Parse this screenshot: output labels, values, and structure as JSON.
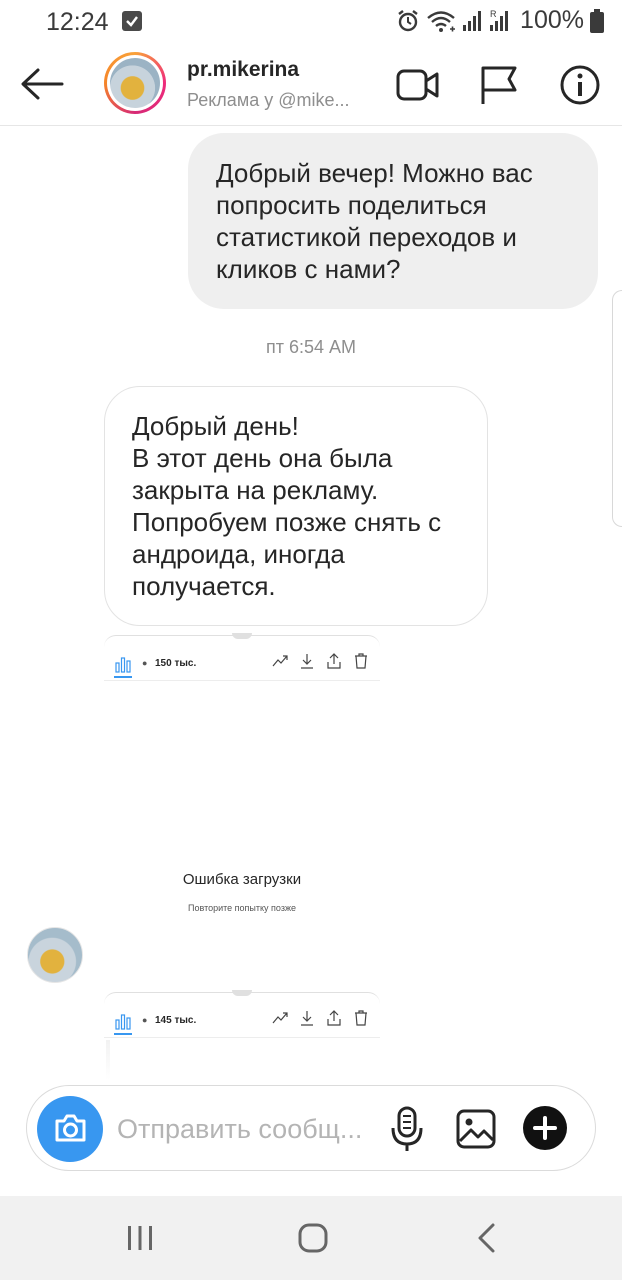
{
  "status_bar": {
    "time": "12:24",
    "battery": "100%"
  },
  "header": {
    "username": "pr.mikerina",
    "subtitle": "Реклама у @mike..."
  },
  "messages": [
    {
      "direction": "outgoing",
      "text": "Добрый вечер! Можно вас попросить поделиться статистикой переходов и кликов с нами?"
    },
    {
      "timestamp": "пт 6:54 AM"
    },
    {
      "direction": "incoming",
      "text": "Добрый день!\nВ этот день она была закрыта на рекламу.\nПопробуем  позже снять с андроида, иногда получается."
    }
  ],
  "shared_cards": [
    {
      "views": "150 тыс."
    },
    {
      "views": "145 тыс."
    }
  ],
  "media_error": {
    "title": "Ошибка загрузки",
    "subtitle": "Повторите попытку позже"
  },
  "composer": {
    "placeholder": "Отправить сообщ..."
  },
  "colors": {
    "accent": "#3897f0",
    "bubble_outgoing": "#efefef",
    "nav_bar": "#f1f1f1",
    "text_secondary": "#8e8e8e"
  },
  "icons": {
    "header": [
      "back-arrow-icon",
      "video-call-icon",
      "flag-icon",
      "info-icon"
    ],
    "card_actions": [
      "insights-icon",
      "trend-icon",
      "download-icon",
      "share-icon",
      "trash-icon"
    ],
    "composer": [
      "camera-icon",
      "microphone-icon",
      "gallery-icon",
      "plus-icon"
    ],
    "nav": [
      "recents-icon",
      "home-icon",
      "nav-back-icon"
    ]
  }
}
